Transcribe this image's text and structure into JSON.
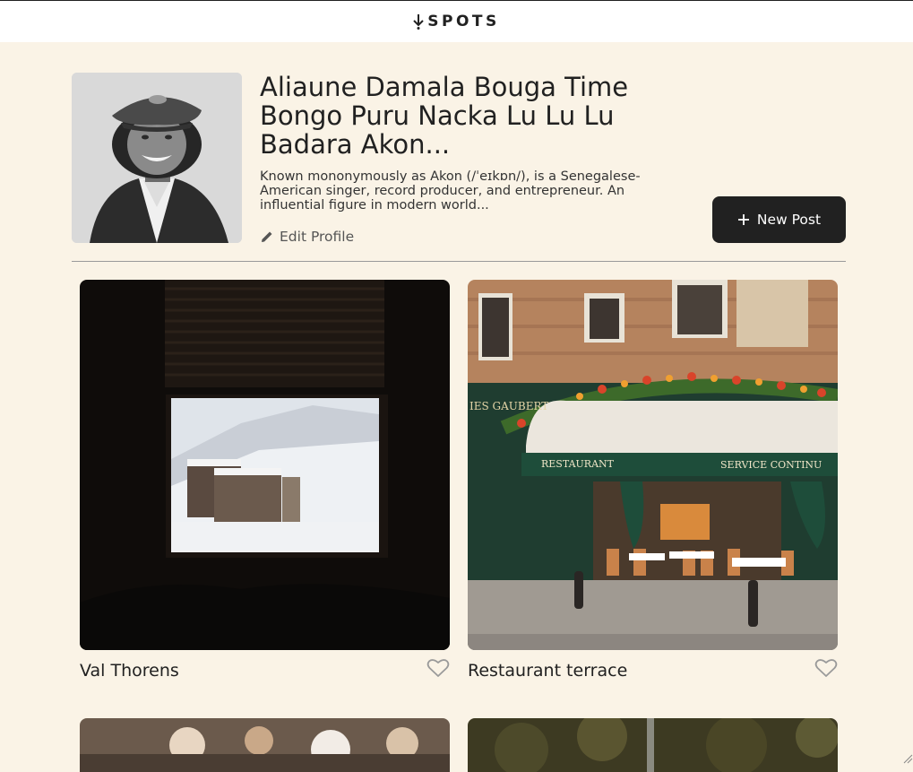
{
  "header": {
    "logo_text": "SPOTS"
  },
  "profile": {
    "name": "Aliaune Damala Bouga Time Bongo Puru Nacka Lu Lu Lu Badara Akon...",
    "bio": "Known mononymously as Akon (/ˈeɪkɒn/), is a Senegalese-American singer, record producer, and entrepreneur. An influential figure in modern world...",
    "edit_label": "Edit Profile",
    "new_post_label": "New Post"
  },
  "cards": [
    {
      "title": "Val Thorens",
      "liked": false
    },
    {
      "title": "Restaurant terrace",
      "liked": false
    }
  ],
  "colors": {
    "background": "#FAF3E6",
    "dark": "#212121",
    "header_bg": "#FFFFFF"
  }
}
